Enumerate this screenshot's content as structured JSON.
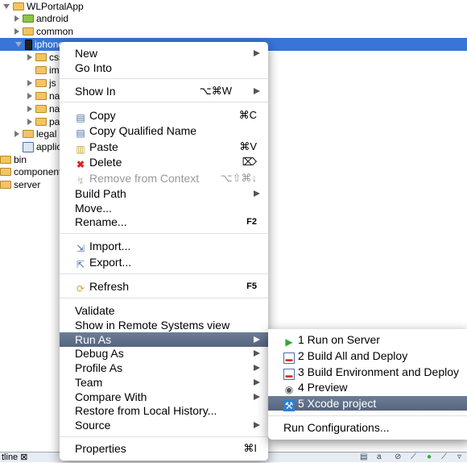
{
  "tree": [
    {
      "label": "WLPortalApp",
      "icon": "project-icon"
    },
    {
      "label": "android",
      "icon": "android-icon"
    },
    {
      "label": "common",
      "icon": "folder-icon"
    },
    {
      "label": "iphone",
      "icon": "iphone-icon"
    },
    {
      "label": "css",
      "icon": "folder-icon"
    },
    {
      "label": "images",
      "icon": "folder-icon"
    },
    {
      "label": "js",
      "icon": "folder-icon"
    },
    {
      "label": "native",
      "icon": "folder-icon"
    },
    {
      "label": "nativeResources",
      "icon": "folder-icon"
    },
    {
      "label": "packages",
      "icon": "folder-icon"
    },
    {
      "label": "legal",
      "icon": "folder-icon"
    },
    {
      "label": "application-descriptor.xml",
      "icon": "xml-file-icon"
    },
    {
      "label": "bin",
      "icon": "folder-icon"
    },
    {
      "label": "components",
      "icon": "folder-icon"
    },
    {
      "label": "server",
      "icon": "folder-icon"
    }
  ],
  "context_menu": {
    "new": "New",
    "go_into": "Go Into",
    "show_in": "Show In",
    "show_in_sc": "⌥⌘W",
    "copy": "Copy",
    "copy_sc": "⌘C",
    "copy_qualified": "Copy Qualified Name",
    "paste": "Paste",
    "paste_sc": "⌘V",
    "delete": "Delete",
    "delete_sc": "⌦",
    "remove": "Remove from Context",
    "remove_sc": "⌥⇧⌘↓",
    "build_path": "Build Path",
    "move": "Move...",
    "rename": "Rename...",
    "rename_sc": "F2",
    "import": "Import...",
    "export": "Export...",
    "refresh": "Refresh",
    "refresh_sc": "F5",
    "validate": "Validate",
    "show_remote": "Show in Remote Systems view",
    "run_as": "Run As",
    "debug_as": "Debug As",
    "profile_as": "Profile As",
    "team": "Team",
    "compare_with": "Compare With",
    "restore": "Restore from Local History...",
    "source": "Source",
    "properties": "Properties",
    "properties_sc": "⌘I"
  },
  "submenu": {
    "run_on_server": "1 Run on Server",
    "build_all": "2 Build All and Deploy",
    "build_env": "3 Build Environment and Deploy",
    "preview": "4 Preview",
    "xcode": "5 Xcode project",
    "run_configs": "Run Configurations..."
  },
  "bottom": {
    "tab": "tline",
    "tab_close": "⊠"
  },
  "colors": {
    "selection": "#3875d7",
    "menu_highlight": "#5f6f89"
  }
}
